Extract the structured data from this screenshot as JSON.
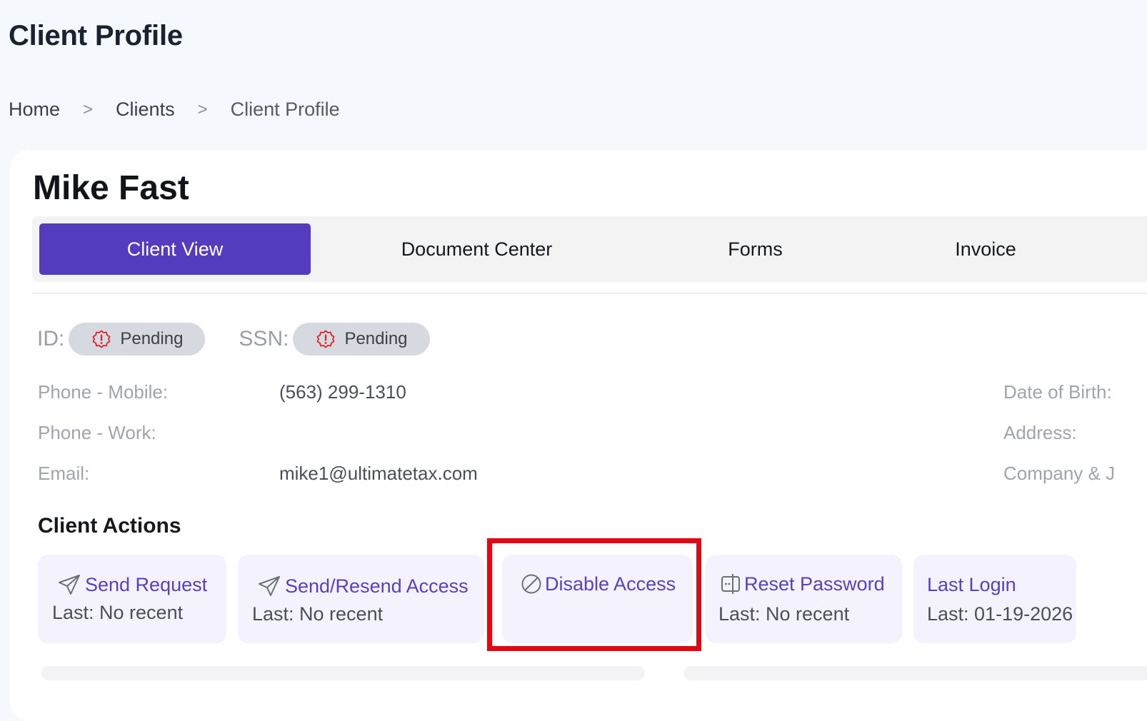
{
  "page": {
    "title": "Client Profile"
  },
  "breadcrumb": {
    "items": [
      "Home",
      "Clients",
      "Client Profile"
    ],
    "separator": ">"
  },
  "client": {
    "name": "Mike Fast"
  },
  "tabs": [
    {
      "label": "Client View",
      "active": true
    },
    {
      "label": "Document Center",
      "active": false
    },
    {
      "label": "Forms",
      "active": false
    },
    {
      "label": "Invoice",
      "active": false
    }
  ],
  "verification": {
    "id_label": "ID:",
    "id_status": "Pending",
    "ssn_label": "SSN:",
    "ssn_status": "Pending",
    "status_icon": "alert-badge-icon",
    "status_icon_color": "#e0242b"
  },
  "info": {
    "phone_mobile_label": "Phone - Mobile:",
    "phone_mobile_value": "(563) 299-1310",
    "phone_work_label": "Phone - Work:",
    "phone_work_value": "",
    "email_label": "Email:",
    "email_value": "mike1@ultimatetax.com",
    "dob_label": "Date of Birth:",
    "address_label": "Address:",
    "company_label": "Company & J"
  },
  "client_actions": {
    "title": "Client Actions",
    "items": [
      {
        "label": "Send Request",
        "sub": "Last: No recent",
        "icon": "send-icon"
      },
      {
        "label": "Send/Resend Access",
        "sub": "Last: No recent",
        "icon": "send-icon"
      },
      {
        "label": "Disable Access",
        "sub": "",
        "icon": "block-icon"
      },
      {
        "label": "Reset Password",
        "sub": "Last: No recent",
        "icon": "password-icon"
      },
      {
        "label": "Last Login",
        "sub": "Last: 01-19-2026",
        "icon": ""
      }
    ]
  },
  "colors": {
    "accent": "#553bbd",
    "action_text": "#5a3fbf",
    "action_bg": "#f4f3fd",
    "highlight": "#e30613",
    "page_bg": "#f5f8fc"
  }
}
